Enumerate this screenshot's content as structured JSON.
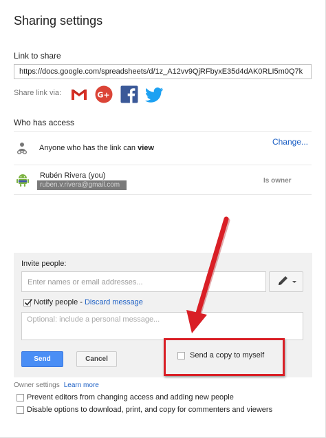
{
  "dialog": {
    "title": "Sharing settings",
    "link_section_label": "Link to share",
    "link_url": "https://docs.google.com/spreadsheets/d/1z_A12vv9QjRFbyxE35d4dAK0RLI5m0Q7k",
    "share_via_label": "Share link via:",
    "social_icons": [
      "gmail-icon",
      "google-plus-icon",
      "facebook-icon",
      "twitter-icon"
    ],
    "who_has_access_label": "Who has access"
  },
  "access": {
    "anyone_text_prefix": "Anyone who has the link can",
    "anyone_permission": "view",
    "change_label": "Change...",
    "user_name": "Rubén Rivera (you)",
    "user_email": "ruben.v.rivera@gmail.com",
    "owner_label": "Is owner"
  },
  "invite": {
    "label": "Invite people:",
    "input_placeholder": "Enter names or email addresses...",
    "notify_label": "Notify people -",
    "notify_checked": true,
    "discard_label": "Discard message",
    "message_placeholder": "Optional: include a personal message...",
    "send_label": "Send",
    "cancel_label": "Cancel",
    "copy_label": "Send a copy to myself",
    "copy_checked": false
  },
  "owner_settings": {
    "label": "Owner settings",
    "learn_more": "Learn more",
    "option_prevent": "Prevent editors from changing access and adding new people",
    "option_disable": "Disable options to download, print, and copy for commenters and viewers"
  },
  "colors": {
    "accent_blue": "#4a8ef5",
    "link_blue": "#1a5ec4",
    "annotation_red": "#d91f26"
  }
}
